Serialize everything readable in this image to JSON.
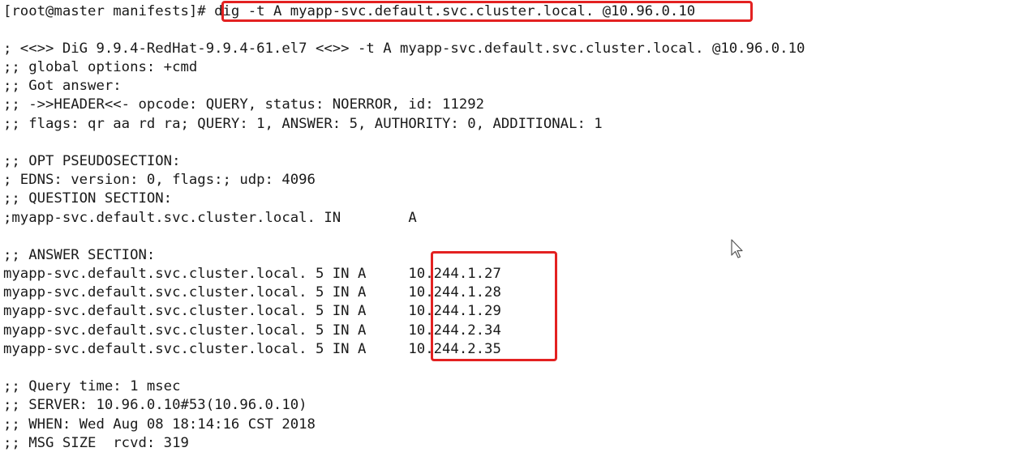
{
  "terminal": {
    "prompt": "[root@master manifests]# ",
    "command": "dig -t A myapp-svc.default.svc.cluster.local. @10.96.0.10",
    "output": [
      "; <<>> DiG 9.9.4-RedHat-9.9.4-61.el7 <<>> -t A myapp-svc.default.svc.cluster.local. @10.96.0.10",
      ";; global options: +cmd",
      ";; Got answer:",
      ";; ->>HEADER<<- opcode: QUERY, status: NOERROR, id: 11292",
      ";; flags: qr aa rd ra; QUERY: 1, ANSWER: 5, AUTHORITY: 0, ADDITIONAL: 1",
      ";; OPT PSEUDOSECTION:",
      "; EDNS: version: 0, flags:; udp: 4096",
      ";; QUESTION SECTION:",
      ";myapp-svc.default.svc.cluster.local. IN        A",
      ";; ANSWER SECTION:",
      "myapp-svc.default.svc.cluster.local. 5 IN A     10.244.1.27",
      "myapp-svc.default.svc.cluster.local. 5 IN A     10.244.1.28",
      "myapp-svc.default.svc.cluster.local. 5 IN A     10.244.1.29",
      "myapp-svc.default.svc.cluster.local. 5 IN A     10.244.2.34",
      "myapp-svc.default.svc.cluster.local. 5 IN A     10.244.2.35",
      ";; Query time: 1 msec",
      ";; SERVER: 10.96.0.10#53(10.96.0.10)",
      ";; WHEN: Wed Aug 08 18:14:16 CST 2018",
      ";; MSG SIZE  rcvd: 319"
    ]
  },
  "colors": {
    "highlight": "#e32121",
    "text": "#1a1a1a",
    "background": "#ffffff"
  }
}
